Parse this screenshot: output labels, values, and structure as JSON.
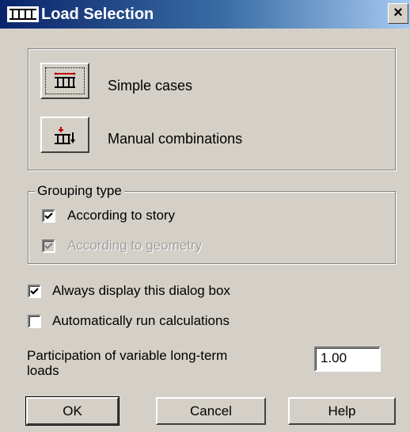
{
  "window": {
    "title": "Load Selection",
    "close_label": "×"
  },
  "cases": {
    "simple_label": "Simple cases",
    "manual_label": "Manual combinations"
  },
  "grouping": {
    "title": "Grouping type",
    "according_story": {
      "label": "According to story",
      "checked": true,
      "enabled": true
    },
    "according_geometry": {
      "label": "According to geometry",
      "checked": true,
      "enabled": false
    }
  },
  "options": {
    "always_display": {
      "label": "Always display this dialog box",
      "checked": true
    },
    "auto_run": {
      "label": "Automatically run calculations",
      "checked": false
    }
  },
  "participation": {
    "label_line1": "Participation of variable long-term",
    "label_line2": "loads",
    "value": "1.00"
  },
  "buttons": {
    "ok": "OK",
    "cancel": "Cancel",
    "help": "Help"
  },
  "colors": {
    "face": "#d4d0c8",
    "title_start": "#0a246a",
    "title_end": "#a6caf0"
  }
}
